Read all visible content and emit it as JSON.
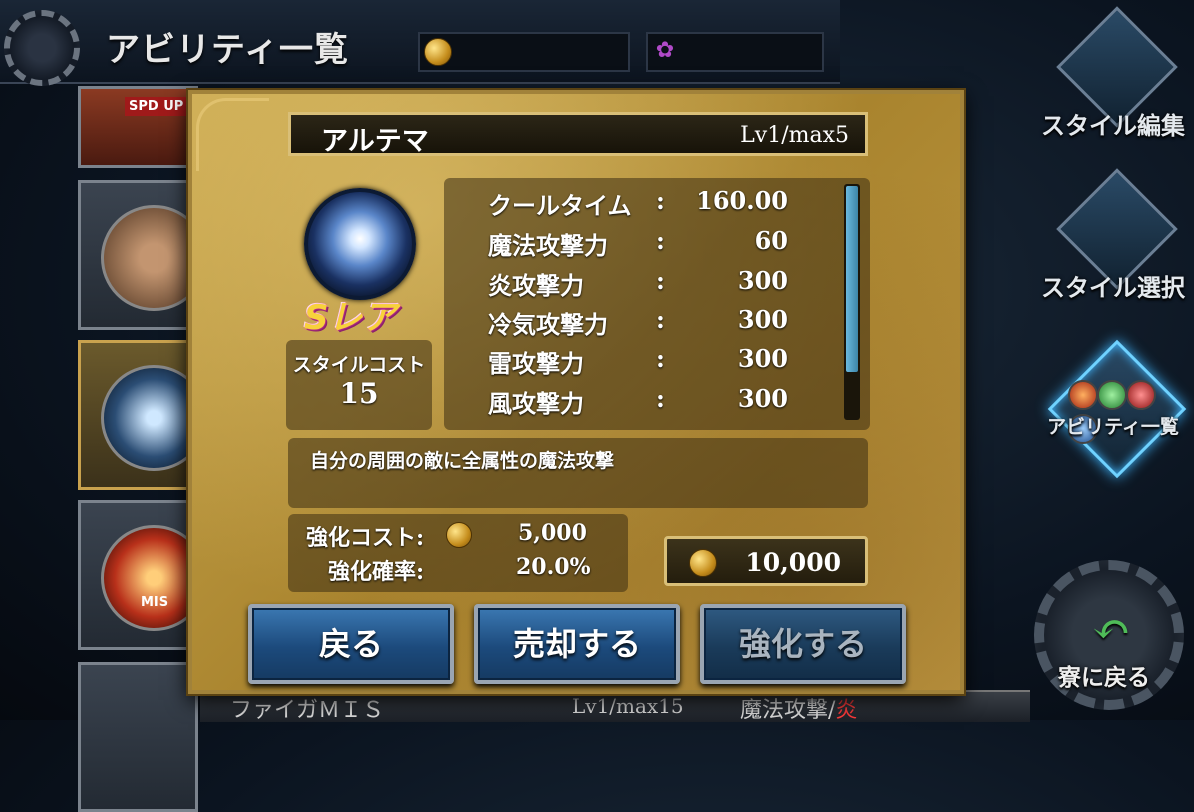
{
  "header": {
    "title": "アビリティ一覧",
    "gil_icon": "gil-coin-icon",
    "gem_icon": "gem-icon"
  },
  "side_menu": {
    "style_edit": "スタイル編集",
    "style_select": "スタイル選択",
    "ability_list": "アビリティ一覧",
    "back_to_dorm": "寮に戻る"
  },
  "background_list": {
    "card1_badge": "SPD UP",
    "card4_badge": "MIS",
    "footer_name": "ファイガＭＩＳ",
    "footer_level": "Lv1/max15",
    "footer_type": "魔法攻撃/",
    "footer_element": "炎"
  },
  "dialog": {
    "ability_name": "アルテマ",
    "level": "Lv1/max5",
    "rarity": "Sレア",
    "style_cost_label": "スタイルコスト",
    "style_cost_value": "15",
    "stats": [
      {
        "label": "クールタイム",
        "colon": ":",
        "value": "160.00"
      },
      {
        "label": "魔法攻撃力",
        "colon": ":",
        "value": "60"
      },
      {
        "label": "炎攻撃力",
        "colon": ":",
        "value": "300"
      },
      {
        "label": "冷気攻撃力",
        "colon": ":",
        "value": "300"
      },
      {
        "label": "雷攻撃力",
        "colon": ":",
        "value": "300"
      },
      {
        "label": "風攻撃力",
        "colon": ":",
        "value": "300"
      }
    ],
    "description": "自分の周囲の敵に全属性の魔法攻撃",
    "upgrade_cost_label": "強化コスト:",
    "upgrade_cost_value": "5,000",
    "upgrade_rate_label": "強化確率:",
    "upgrade_rate_value": "20.0%",
    "owned_gil": "10,000",
    "buttons": {
      "back": "戻る",
      "sell": "売却する",
      "upgrade": "強化する"
    }
  },
  "colors": {
    "accent_blue": "#3fb7ff",
    "parchment": "#c9a74e",
    "fire": "#ff3b3b"
  }
}
